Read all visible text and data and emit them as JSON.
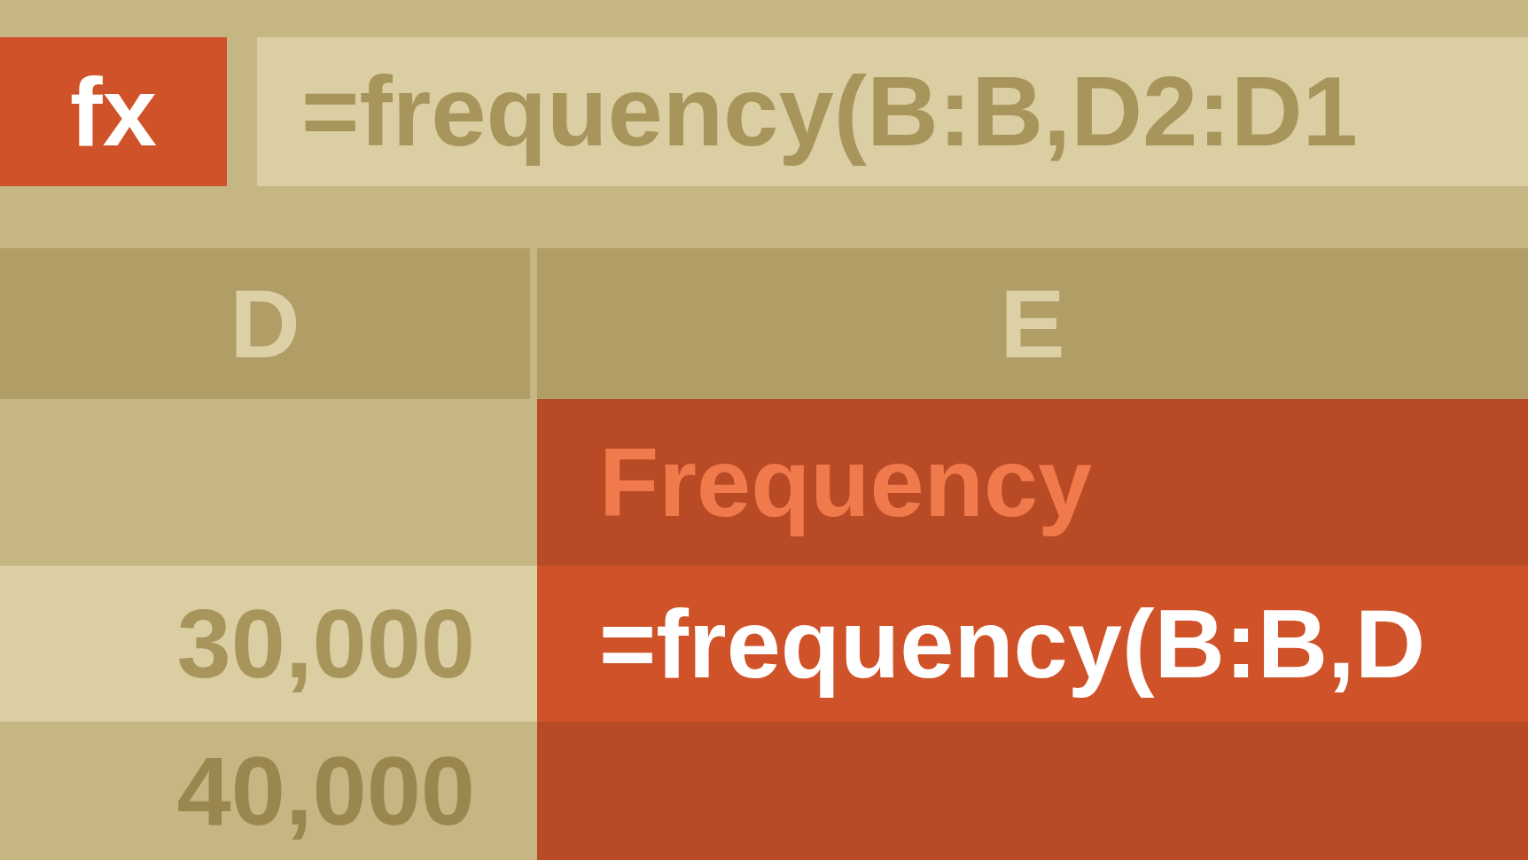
{
  "formula_bar": {
    "function_label": "fx",
    "formula": "=frequency(B:B,D2:D1"
  },
  "columns": [
    {
      "label": "D"
    },
    {
      "label": "E"
    }
  ],
  "rows": [
    {
      "cells": [
        "",
        "Frequency"
      ],
      "selected": false
    },
    {
      "cells": [
        "30,000",
        "=frequency(B:B,D"
      ],
      "selected": true
    },
    {
      "cells": [
        "40,000",
        ""
      ],
      "selected": false
    }
  ]
}
